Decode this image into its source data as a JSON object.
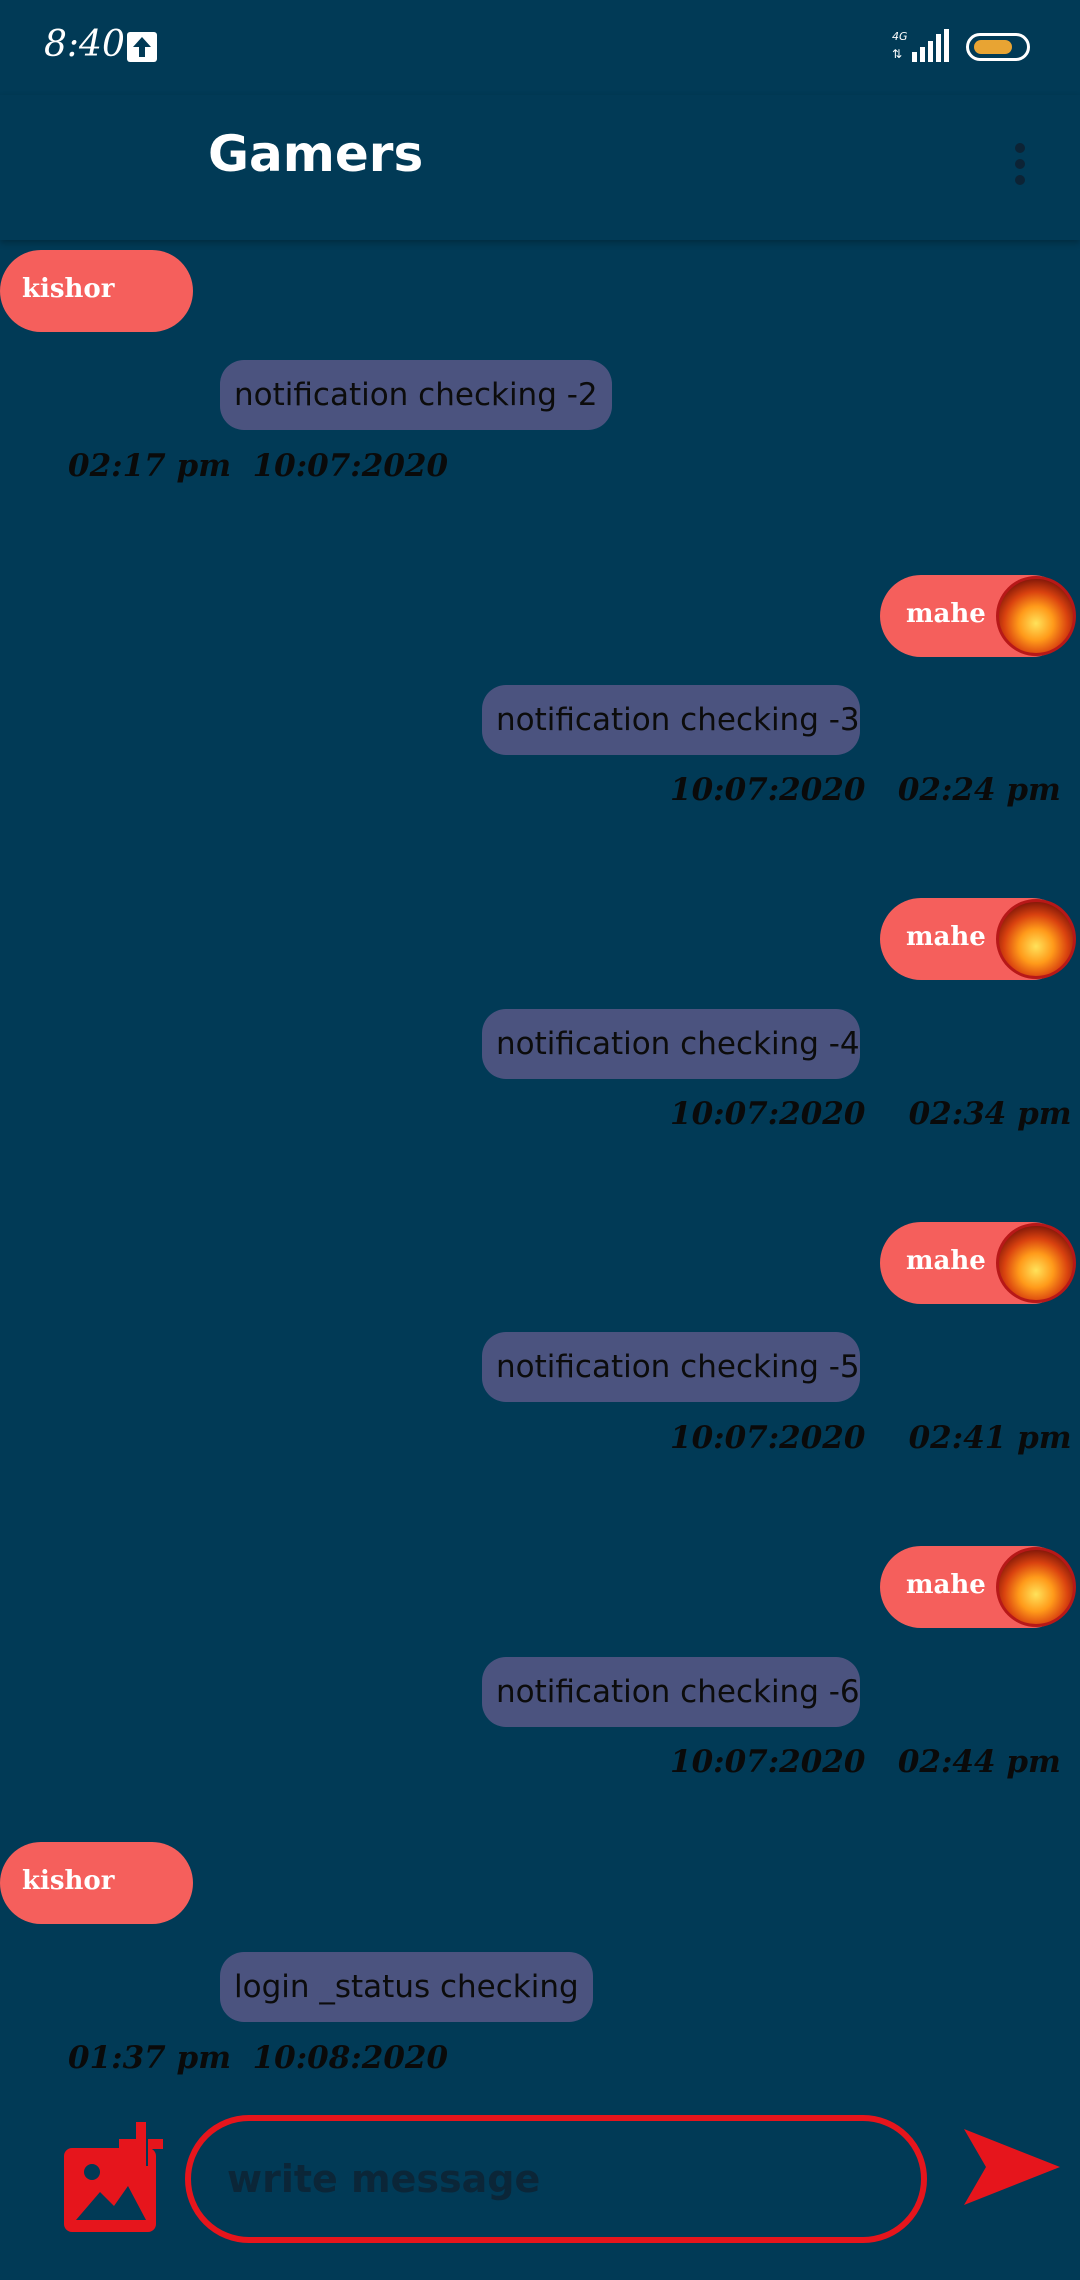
{
  "status_bar": {
    "time": "8:40",
    "network_label": "4G",
    "battery_color": "#e8a433"
  },
  "app_bar": {
    "title": "Gamers",
    "menu_icon": "more-vert-icon"
  },
  "messages": [
    {
      "sender": "kishor",
      "side": "left",
      "text": "notification checking -2",
      "timestamp": "02:17 pm  10:07:2020"
    },
    {
      "sender": "mahe",
      "side": "right",
      "text": "notification checking -3",
      "timestamp": "10:07:2020   02:24 pm"
    },
    {
      "sender": "mahe",
      "side": "right",
      "text": "notification checking -4",
      "timestamp": "10:07:2020    02:34 pm"
    },
    {
      "sender": "mahe",
      "side": "right",
      "text": "notification checking -5",
      "timestamp": "10:07:2020    02:41 pm"
    },
    {
      "sender": "mahe",
      "side": "right",
      "text": "notification checking -6",
      "timestamp": "10:07:2020   02:44 pm"
    },
    {
      "sender": "kishor",
      "side": "left",
      "text": "login _status checking",
      "timestamp": "01:37 pm  10:08:2020"
    }
  ],
  "composer": {
    "placeholder": "write message",
    "value": "",
    "attach_icon": "add-image-icon",
    "send_icon": "send-icon"
  },
  "colors": {
    "background": "#013a56",
    "name_pill": "#f55f5c",
    "bubble": "#4b537f",
    "accent_red": "#e6151c"
  }
}
